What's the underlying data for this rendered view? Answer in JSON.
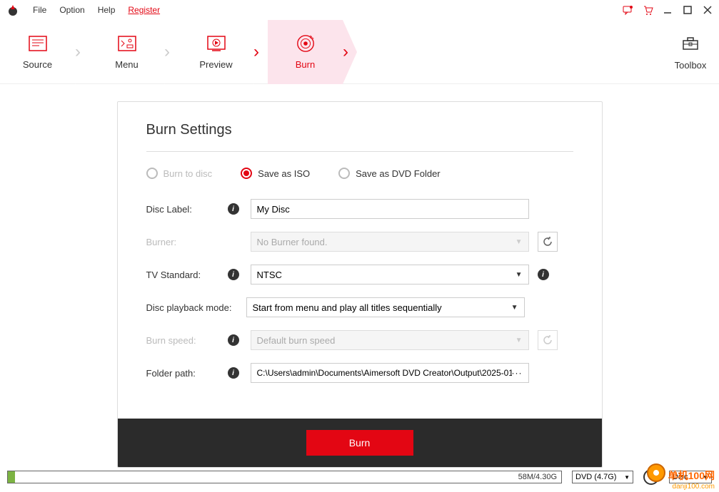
{
  "menu": {
    "file": "File",
    "option": "Option",
    "help": "Help",
    "register": "Register"
  },
  "steps": {
    "source": "Source",
    "menu": "Menu",
    "preview": "Preview",
    "burn": "Burn",
    "toolbox": "Toolbox"
  },
  "panel": {
    "title": "Burn Settings",
    "radios": {
      "burn_to_disc": "Burn to disc",
      "save_as_iso": "Save as ISO",
      "save_as_dvd_folder": "Save as DVD Folder"
    },
    "labels": {
      "disc_label": "Disc Label:",
      "burner": "Burner:",
      "tv_standard": "TV Standard:",
      "disc_playback": "Disc playback mode:",
      "burn_speed": "Burn speed:",
      "folder_path": "Folder path:"
    },
    "values": {
      "disc_label": "My Disc",
      "burner": "No Burner found.",
      "tv_standard": "NTSC",
      "disc_playback": "Start from menu and play all titles sequentially",
      "burn_speed": "Default burn speed",
      "folder_path": "C:\\Users\\admin\\Documents\\Aimersoft DVD Creator\\Output\\2025-01-"
    },
    "burn_button": "Burn"
  },
  "bottombar": {
    "progress_text": "58M/4.30G",
    "progress_percent": 1.3,
    "dvd_type": "DVD (4.7G)",
    "disc_label": "Disc"
  },
  "watermark": {
    "line1": "单机100网",
    "line2": "danji100.com"
  }
}
